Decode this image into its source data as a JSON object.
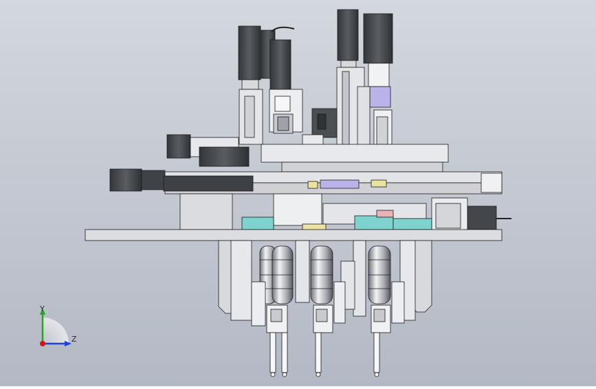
{
  "triad": {
    "y_label": "Y",
    "z_label": "Z",
    "colors": {
      "y": "#2aa02a",
      "z": "#1f3fd8",
      "x": "#d01818"
    }
  },
  "palette": {
    "motor_dark": "#4a4d52",
    "metal_light": "#e6e8ec",
    "metal_mid": "#b9bcc2",
    "outline": "#1a1a1a",
    "plate": "#dcdde0",
    "cyan_part": "#7fd3cf",
    "pink_part": "#e8b2b6",
    "lavender_part": "#b9b3ea",
    "yellow_part": "#ece3a0"
  }
}
